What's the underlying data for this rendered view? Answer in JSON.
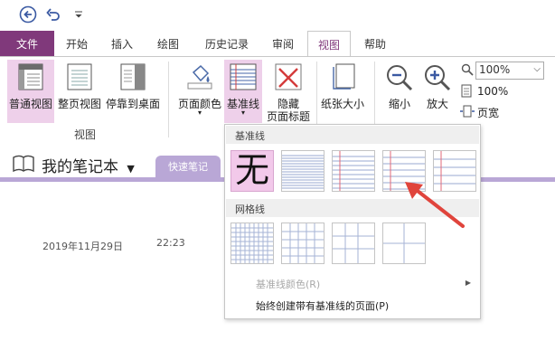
{
  "titlebar": {
    "back_icon": "back-arrow-icon",
    "undo_icon": "undo-icon",
    "customize_icon": "customize-qat-icon"
  },
  "tabs": {
    "file": "文件",
    "items": [
      "开始",
      "插入",
      "绘图",
      "历史记录",
      "审阅",
      "视图",
      "帮助"
    ],
    "active": "视图"
  },
  "ribbon": {
    "normal_view": "普通视图",
    "full_page_view": "整页视图",
    "dock_to_desktop": "停靠到桌面",
    "views_group": "视图",
    "page_color": "页面颜色",
    "rule_lines": "基准线",
    "hide_title_1": "隐藏",
    "hide_title_2": "页面标题",
    "paper_size": "纸张大小",
    "zoom_out": "缩小",
    "zoom_in": "放大",
    "zoom_value": "100%",
    "zoom_100": "100%",
    "page_width": "页宽"
  },
  "notebook": {
    "title": "我的笔记本",
    "section": "快速笔记",
    "date": "2019年11月29日",
    "time": "22:23"
  },
  "gallery": {
    "rule_lines_header": "基准线",
    "none_label": "无",
    "grid_lines_header": "网格线",
    "rule_line_color": "基准线颜色(R)",
    "always_create": "始终创建带有基准线的页面(P)"
  },
  "colors": {
    "accent": "#80397b",
    "section": "#b9a7d6",
    "selected": "#eed0ea",
    "arrow": "#e0443c"
  }
}
